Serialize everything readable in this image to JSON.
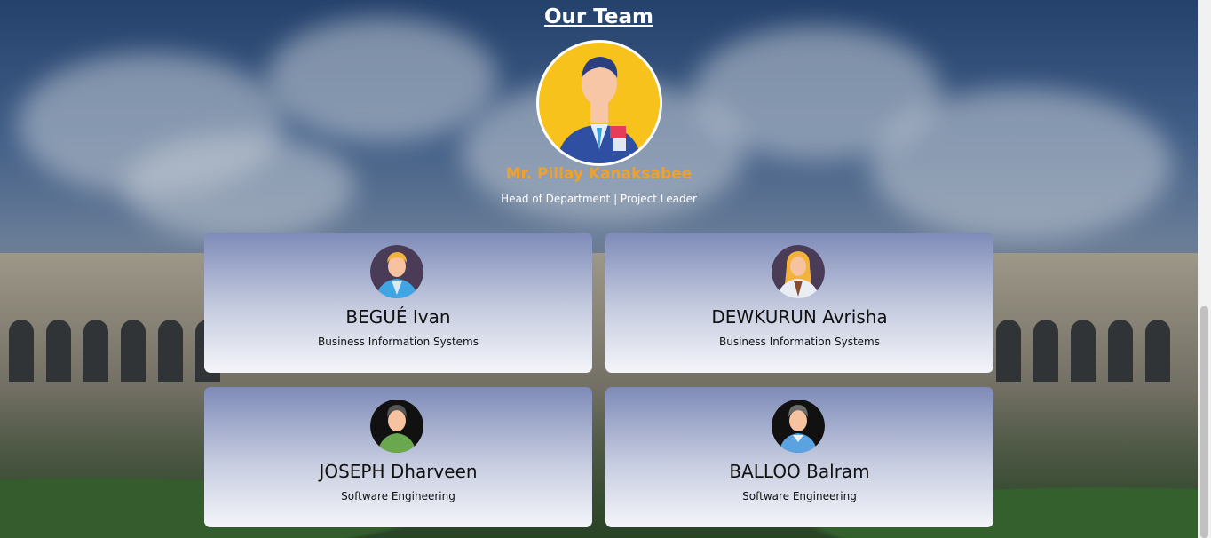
{
  "section": {
    "title": "Our Team"
  },
  "leader": {
    "name": "Mr. Pillay Kanaksabee",
    "role": "Head of Department | Project Leader",
    "avatar_icon": "businessman-avatar-icon"
  },
  "members": [
    {
      "name": "BEGUÉ Ivan",
      "department": "Business Information Systems",
      "avatar_icon": "man-blond-avatar-icon"
    },
    {
      "name": "DEWKURUN Avrisha",
      "department": "Business Information Systems",
      "avatar_icon": "woman-avatar-icon"
    },
    {
      "name": "JOSEPH Dharveen",
      "department": "Software Engineering",
      "avatar_icon": "man-green-shirt-avatar-icon"
    },
    {
      "name": "BALLOO Balram",
      "department": "Software Engineering",
      "avatar_icon": "man-blue-shirt-avatar-icon"
    }
  ],
  "colors": {
    "leader_name": "#f0a12a",
    "card_top": "#7e8bb8",
    "card_bottom": "#f4f5fa"
  }
}
